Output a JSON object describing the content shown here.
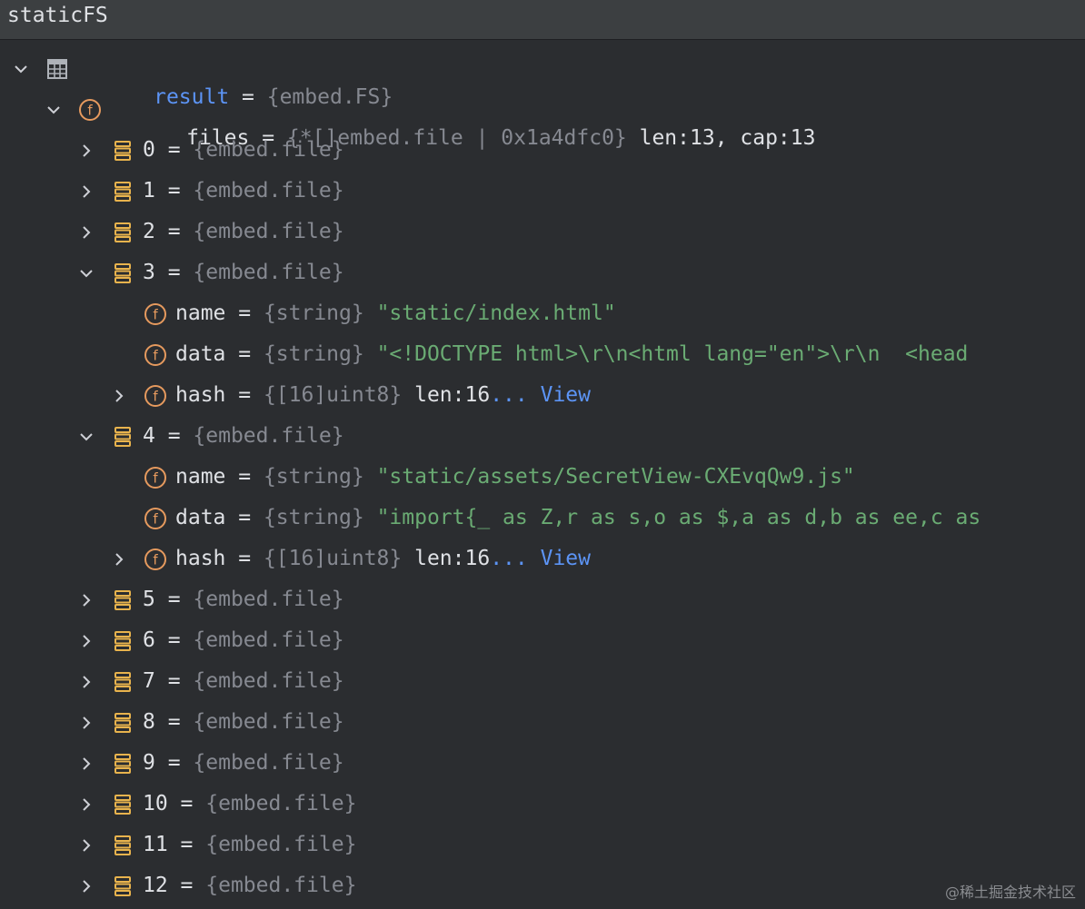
{
  "window": {
    "title": "staticFS"
  },
  "tree": {
    "root": {
      "name": "result",
      "eq": " = ",
      "type": "{embed.FS}"
    },
    "files": {
      "name": "files",
      "eq": " = ",
      "type": "{*[]embed.file | 0x1a4dfc0}",
      "info": " len:13, cap:13"
    },
    "items": [
      {
        "index": "0",
        "eq": " = ",
        "type": "{embed.file}"
      },
      {
        "index": "1",
        "eq": " = ",
        "type": "{embed.file}"
      },
      {
        "index": "2",
        "eq": " = ",
        "type": "{embed.file}"
      },
      {
        "index": "3",
        "eq": " = ",
        "type": "{embed.file}",
        "fields": {
          "name": {
            "label": "name",
            "eq": " = ",
            "type": "{string}",
            "value": " \"static/index.html\""
          },
          "data": {
            "label": "data",
            "eq": " = ",
            "type": "{string}",
            "value": " \"<!DOCTYPE html>\\r\\n<html lang=\"en\">\\r\\n  <head"
          },
          "hash": {
            "label": "hash",
            "eq": " = ",
            "type": "{[16]uint8}",
            "info": " len:16",
            "ellipsis": "... ",
            "link": "View"
          }
        }
      },
      {
        "index": "4",
        "eq": " = ",
        "type": "{embed.file}",
        "fields": {
          "name": {
            "label": "name",
            "eq": " = ",
            "type": "{string}",
            "value": " \"static/assets/SecretView-CXEvqQw9.js\""
          },
          "data": {
            "label": "data",
            "eq": " = ",
            "type": "{string}",
            "value": " \"import{_ as Z,r as s,o as $,a as d,b as ee,c as"
          },
          "hash": {
            "label": "hash",
            "eq": " = ",
            "type": "{[16]uint8}",
            "info": " len:16",
            "ellipsis": "... ",
            "link": "View"
          }
        }
      },
      {
        "index": "5",
        "eq": " = ",
        "type": "{embed.file}"
      },
      {
        "index": "6",
        "eq": " = ",
        "type": "{embed.file}"
      },
      {
        "index": "7",
        "eq": " = ",
        "type": "{embed.file}"
      },
      {
        "index": "8",
        "eq": " = ",
        "type": "{embed.file}"
      },
      {
        "index": "9",
        "eq": " = ",
        "type": "{embed.file}"
      },
      {
        "index": "10",
        "eq": " = ",
        "type": "{embed.file}"
      },
      {
        "index": "11",
        "eq": " = ",
        "type": "{embed.file}"
      },
      {
        "index": "12",
        "eq": " = ",
        "type": "{embed.file}"
      }
    ]
  },
  "watermark": "@稀土掘金技术社区",
  "icons": {
    "expanded": "chevron-down-icon",
    "collapsed": "chevron-right-icon",
    "root": "table-icon",
    "field": "field-f-icon",
    "element": "array-element-icon"
  },
  "colors": {
    "background": "#2b2d30",
    "titlebar": "#3c3f41",
    "identifier": "#5c94f5",
    "type": "#868991",
    "string": "#6aab73",
    "fieldIcon": "#e69a5e",
    "elementIcon": "#e8b34d"
  }
}
